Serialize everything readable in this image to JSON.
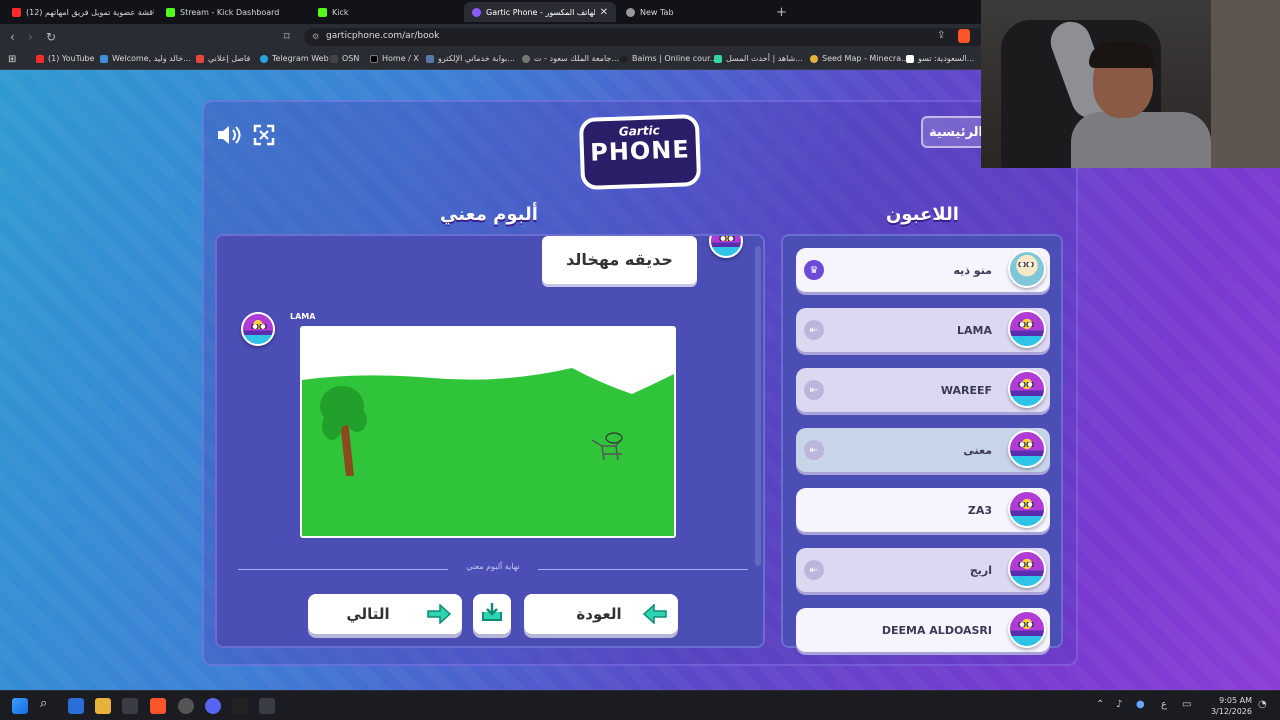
{
  "browser": {
    "tabs": [
      {
        "label": "(12) عاجل مناقشة عضوية تمويل فريق امهاتهم",
        "icon": "youtube-icon",
        "color": "#ff2b2b"
      },
      {
        "label": "Stream - Kick Dashboard",
        "icon": "kick-icon",
        "color": "#53fc18"
      },
      {
        "label": "Kick",
        "icon": "kick-icon",
        "color": "#53fc18"
      },
      {
        "label": "Gartic Phone - لعبة الهاتف المكسور",
        "icon": "gartic-icon",
        "color": "#8a5cff"
      },
      {
        "label": "New Tab",
        "icon": "brave-icon",
        "color": "#999999"
      }
    ],
    "url": "garticphone.com/ar/book",
    "bookmarks": [
      "(1) YouTube",
      "Welcome, خالد وليد...",
      "فاصل إعلاني",
      "Telegram Web",
      "OSN",
      "Home / X",
      "بوابة خدماتي الإلكترو...",
      "جامعة الملك سعود - ت...",
      "Baims | Online cour...",
      "شاهد | أحدث المسل...",
      "Seed Map - Minecra...",
      "السعودية: تسو..."
    ]
  },
  "game": {
    "logo_top": "Gartic",
    "logo_bottom": "PHONE",
    "home_button": "الرئيسية",
    "album_title": "ألبوم معني",
    "players_title": "اللاعبون",
    "prompt_text": "حديقه مهخالد",
    "drawing_author": "LAMA",
    "end_of_album": "نهاية ألبوم معني",
    "next_button": "التالي",
    "back_button": "العودة",
    "players": [
      {
        "name": "منو ذيه",
        "host": true,
        "highlight": true
      },
      {
        "name": "LAMA",
        "host": false,
        "highlight": false
      },
      {
        "name": "WAREEF",
        "host": false,
        "highlight": false
      },
      {
        "name": "معنى",
        "host": false,
        "highlight": false
      },
      {
        "name": "ZA3",
        "host": false,
        "highlight": true
      },
      {
        "name": "اريج",
        "host": false,
        "highlight": false
      },
      {
        "name": "DEEMA ALDOASRI",
        "host": false,
        "highlight": true
      }
    ]
  },
  "taskbar": {
    "time": "9:05 AM",
    "date": "3/12/2026",
    "lang": "ع"
  }
}
